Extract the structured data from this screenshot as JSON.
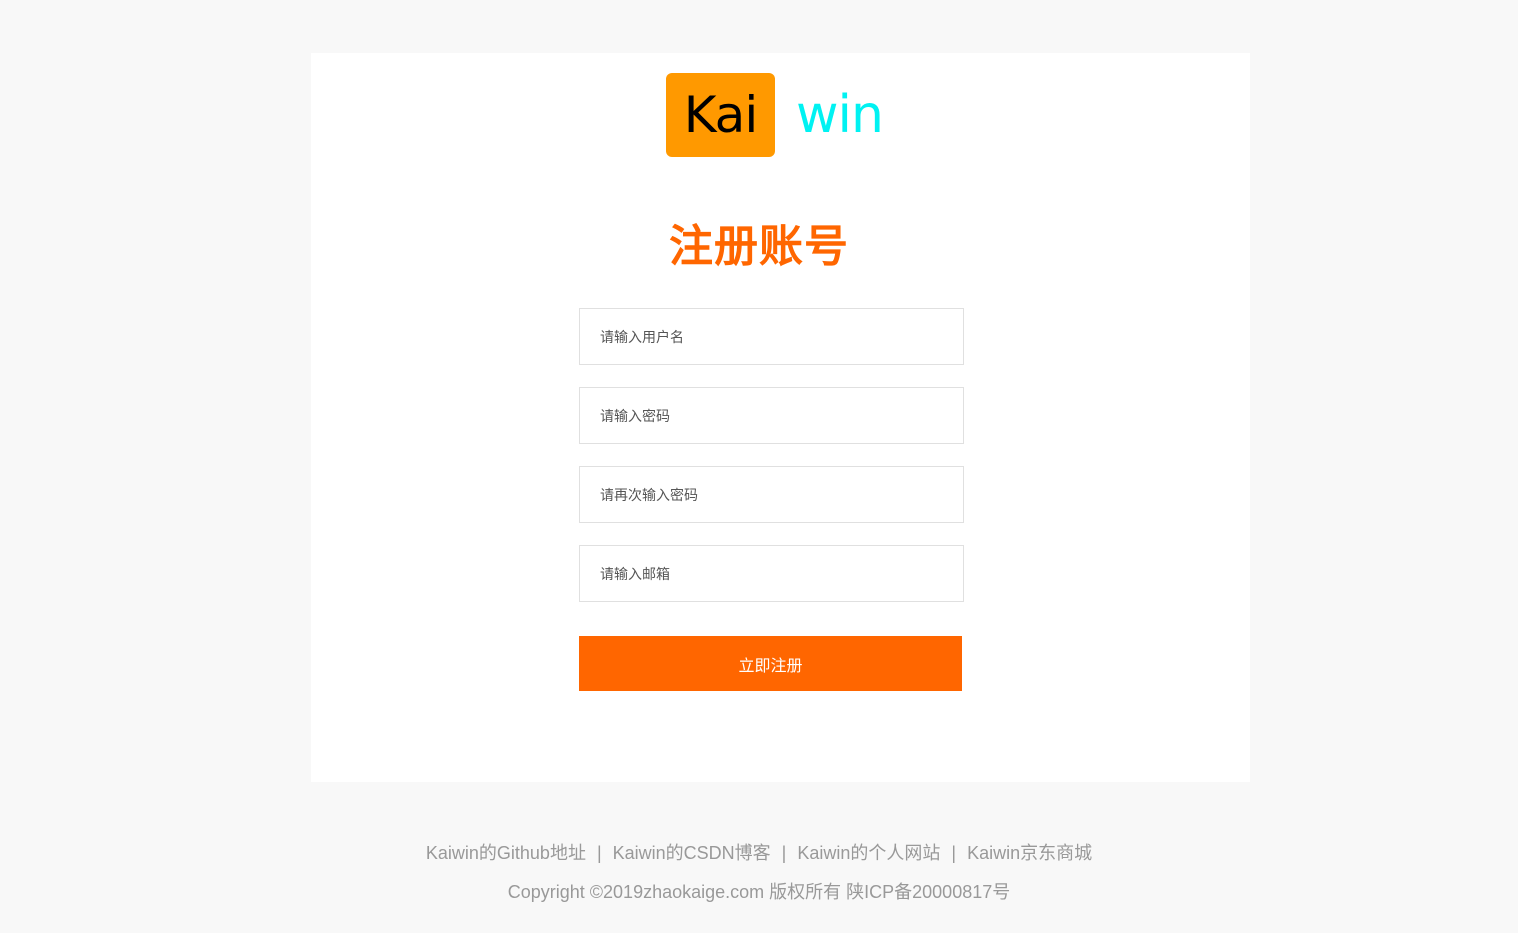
{
  "logo": {
    "box_text": "Kai",
    "tail_text": "win",
    "box_color": "#ff9900",
    "tail_color": "#00f2f2"
  },
  "title": "注册账号",
  "form": {
    "username_placeholder": "请输入用户名",
    "password_placeholder": "请输入密码",
    "confirm_placeholder": "请再次输入密码",
    "email_placeholder": "请输入邮箱",
    "submit_label": "立即注册"
  },
  "footer": {
    "links": [
      {
        "label": "Kaiwin的Github地址"
      },
      {
        "label": "Kaiwin的CSDN博客"
      },
      {
        "label": "Kaiwin的个人网站"
      },
      {
        "label": "Kaiwin京东商城"
      }
    ],
    "separator": "|",
    "copyright": "Copyright ©2019zhaokaige.com 版权所有 陕ICP备20000817号"
  },
  "colors": {
    "accent": "#ff6600",
    "background": "#f8f8f8"
  }
}
